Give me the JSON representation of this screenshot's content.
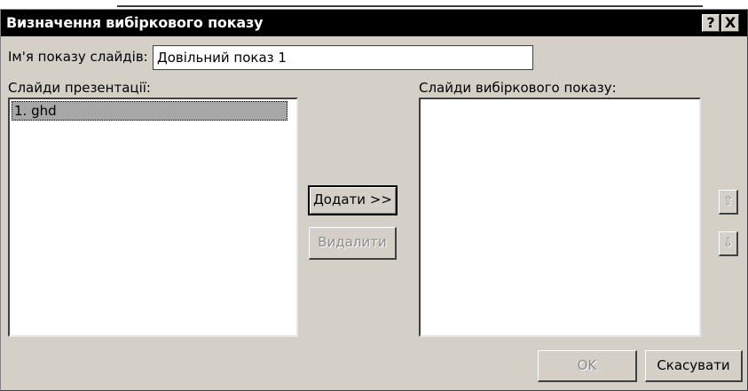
{
  "window": {
    "title": "Визначення вибіркового показу",
    "help_label": "?",
    "close_label": "X"
  },
  "show_name": {
    "label": "Ім'я показу слайдів:",
    "value": "Довільний показ 1"
  },
  "presentation_slides": {
    "label": "Слайди презентації:",
    "items": [
      "1. ghd"
    ],
    "selected_index": 0
  },
  "custom_show_slides": {
    "label": "Слайди вибіркового показу:",
    "items": []
  },
  "buttons": {
    "add_label": "Додати >>",
    "remove_label": "Видалити",
    "ok_label": "OK",
    "cancel_label": "Скасувати"
  },
  "icons": {
    "move_up": "arrow-up-icon",
    "move_down": "arrow-down-icon"
  },
  "colors": {
    "dialog_background": "#d4d0c8",
    "titlebar": "#000000",
    "selection": "#a7a7a7"
  }
}
